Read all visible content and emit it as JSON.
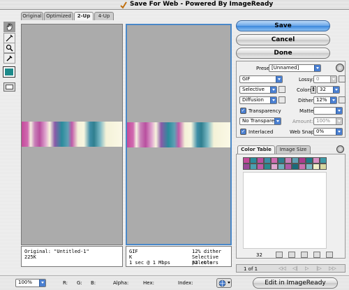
{
  "window": {
    "title": "Save For Web - Powered By ImageReady"
  },
  "tabs": [
    {
      "label": "Original"
    },
    {
      "label": "Optimized"
    },
    {
      "label": "2-Up"
    },
    {
      "label": "4-Up"
    }
  ],
  "active_tab": "2-Up",
  "tools": [
    "hand-tool",
    "slice-select-tool",
    "zoom-tool",
    "eyedropper-tool"
  ],
  "eyedropper_color": "#1d8a8a",
  "left_pane": {
    "line1": "Original: \"Untitled-1\"",
    "line2": "225K"
  },
  "right_pane": {
    "format": "GIF",
    "size": "K",
    "time": "1 sec @ 1 Mbps",
    "dither": "12% dither",
    "palette": "Selective palette",
    "colors": "32 colors"
  },
  "buttons": {
    "save": "Save",
    "cancel": "Cancel",
    "done": "Done",
    "edit_imageready": "Edit in ImageReady"
  },
  "settings": {
    "preset_label": "Preset:",
    "preset_value": "[Unnamed]",
    "format_value": "GIF",
    "lossy_label": "Lossy:",
    "lossy_value": "0",
    "reduction_value": "Selective",
    "colors_label": "Colors:",
    "colors_value": "32",
    "dither_algo_value": "Diffusion",
    "dither_label": "Dither:",
    "dither_value": "12%",
    "transparency_label": "Transparency",
    "matte_label": "Matte:",
    "transparency_dither_value": "No Transpare...",
    "amount_label": "Amount:",
    "amount_value": "100%",
    "interlaced_label": "Interlaced",
    "web_snap_label": "Web Snap:",
    "web_snap_value": "0%"
  },
  "color_table": {
    "tab_color_table": "Color Table",
    "tab_image_size": "Image Size",
    "count": "32",
    "swatches": [
      "#c44a9a",
      "#2a8c9c",
      "#b94f9f",
      "#3f8ea6",
      "#d06ab0",
      "#2f7f8f",
      "#c880b8",
      "#5fa0b4",
      "#aa3c8e",
      "#1f7a88",
      "#d890c4",
      "#3d9aa8",
      "#9a4a98",
      "#4aa0b0",
      "#c05aa8",
      "#2a8a8e",
      "#e0a8d0",
      "#6ab0bc",
      "#b05aa8",
      "#1a6a7a",
      "#cc70b0",
      "#7ab8c4",
      "#f0f0c8",
      "#d8d8a0"
    ]
  },
  "nav": {
    "page": "1 of 1"
  },
  "status": {
    "zoom": "100%",
    "r": "R:",
    "g": "G:",
    "b": "B:",
    "alpha": "Alpha:",
    "hex": "Hex:",
    "index": "Index:"
  }
}
